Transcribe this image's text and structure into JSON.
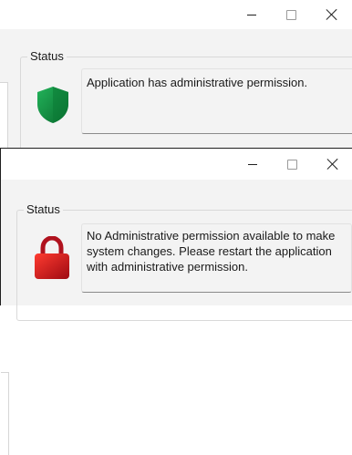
{
  "window_top": {
    "title_buttons": {
      "minimize": "—",
      "maximize": "☐",
      "close": "✕"
    },
    "status_group_label": "Status",
    "status_icon": "shield-icon",
    "status_message": "Application has administrative permission.",
    "accent_color": "#0f8a3c"
  },
  "window_bottom": {
    "title_buttons": {
      "minimize": "—",
      "maximize": "☐",
      "close": "✕"
    },
    "status_group_label": "Status",
    "status_icon": "lock-icon",
    "status_message": "No Administrative permission available to make system changes. Please restart the application with administrative permission.",
    "accent_color": "#c8102e"
  }
}
